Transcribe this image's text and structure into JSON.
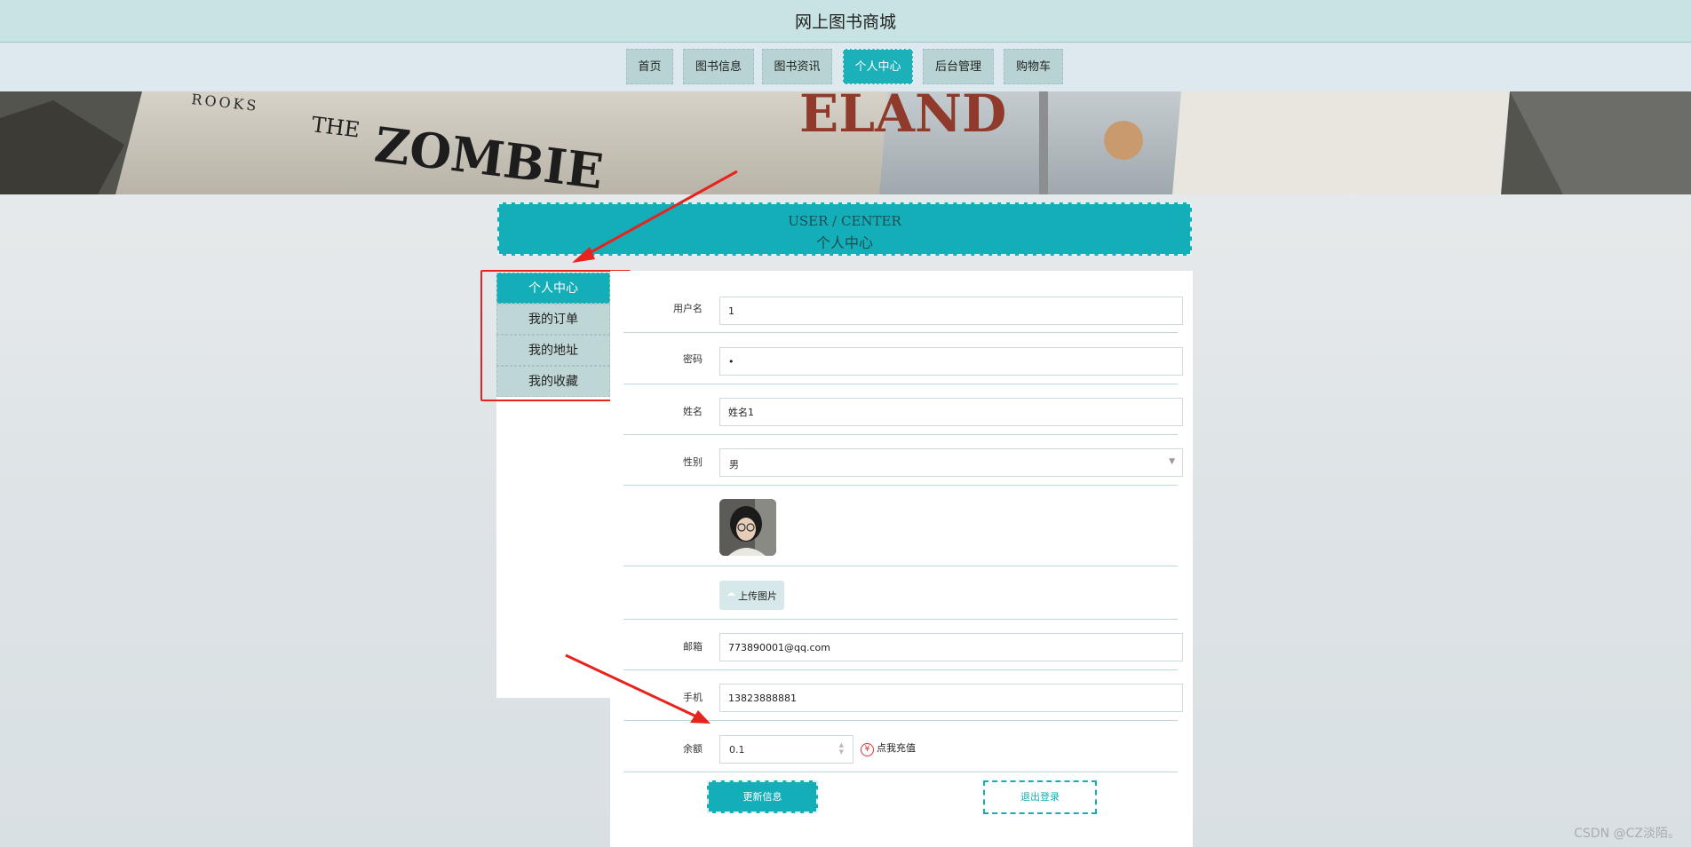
{
  "site": {
    "title": "网上图书商城"
  },
  "nav": {
    "items": [
      "首页",
      "图书信息",
      "图书资讯",
      "个人中心",
      "后台管理",
      "购物车"
    ],
    "active": "个人中心"
  },
  "banner": {
    "texts": [
      "ROOKS",
      "THE",
      "ZOMBIE",
      "ELAND"
    ]
  },
  "section": {
    "en": "USER / CENTER",
    "cn": "个人中心"
  },
  "sidebar": {
    "items": [
      "个人中心",
      "我的订单",
      "我的地址",
      "我的收藏"
    ],
    "active": "个人中心"
  },
  "form": {
    "username": {
      "label": "用户名",
      "value": "1"
    },
    "password": {
      "label": "密码",
      "value": "•"
    },
    "name": {
      "label": "姓名",
      "value": "姓名1"
    },
    "gender": {
      "label": "性别",
      "value": "男"
    },
    "upload_label": "上传图片",
    "email": {
      "label": "邮箱",
      "value": "773890001@qq.com"
    },
    "phone": {
      "label": "手机",
      "value": "13823888881"
    },
    "balance": {
      "label": "余额",
      "value": "0.1"
    },
    "recharge_label": "点我充值",
    "recharge_icon": "¥",
    "update_button": "更新信息",
    "logout_button": "退出登录"
  },
  "watermark": "CSDN @CZ淡陌。",
  "colors": {
    "accent": "#13aeb8",
    "annotation": "#e8231d",
    "nav_bg": "#b7d3d3"
  }
}
